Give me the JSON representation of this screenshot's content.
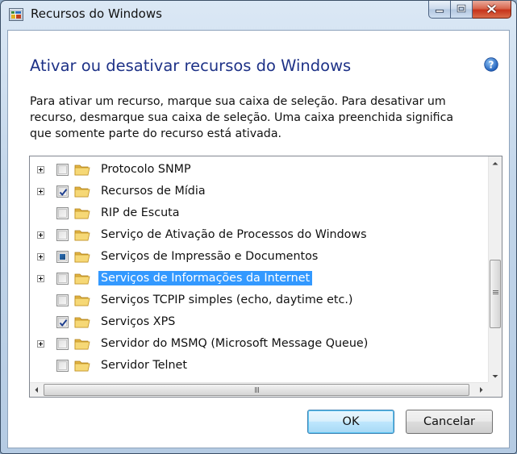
{
  "window": {
    "title": "Recursos do Windows",
    "accent": "#3399ff",
    "heading_color": "#1e3287"
  },
  "header": {
    "heading": "Ativar ou desativar recursos do Windows",
    "description_lines": [
      "Para ativar um recurso, marque sua caixa de seleção. Para desativar um",
      "recurso, desmarque sua caixa de seleção. Uma caixa preenchida significa",
      "que somente parte do recurso está ativada."
    ]
  },
  "features": [
    {
      "label": "Protocolo SNMP",
      "expandable": true,
      "state": "unchecked",
      "selected": false,
      "icon": "folder-icon"
    },
    {
      "label": "Recursos de Mídia",
      "expandable": true,
      "state": "checked",
      "selected": false,
      "icon": "folder-icon"
    },
    {
      "label": "RIP de Escuta",
      "expandable": false,
      "state": "unchecked",
      "selected": false,
      "icon": "folder-icon"
    },
    {
      "label": "Serviço de Ativação de Processos do Windows",
      "expandable": true,
      "state": "unchecked",
      "selected": false,
      "icon": "folder-icon"
    },
    {
      "label": "Serviços de Impressão e Documentos",
      "expandable": true,
      "state": "partial",
      "selected": false,
      "icon": "folder-icon"
    },
    {
      "label": "Serviços de Informações da Internet",
      "expandable": true,
      "state": "unchecked",
      "selected": true,
      "icon": "folder-icon"
    },
    {
      "label": "Serviços TCPIP simples (echo, daytime etc.)",
      "expandable": false,
      "state": "unchecked",
      "selected": false,
      "icon": "folder-icon"
    },
    {
      "label": "Serviços XPS",
      "expandable": false,
      "state": "checked",
      "selected": false,
      "icon": "folder-icon"
    },
    {
      "label": "Servidor do MSMQ (Microsoft Message Queue)",
      "expandable": true,
      "state": "unchecked",
      "selected": false,
      "icon": "folder-icon"
    },
    {
      "label": "Servidor Telnet",
      "expandable": false,
      "state": "unchecked",
      "selected": false,
      "icon": "folder-icon"
    }
  ],
  "buttons": {
    "ok": "OK",
    "cancel": "Cancelar"
  }
}
